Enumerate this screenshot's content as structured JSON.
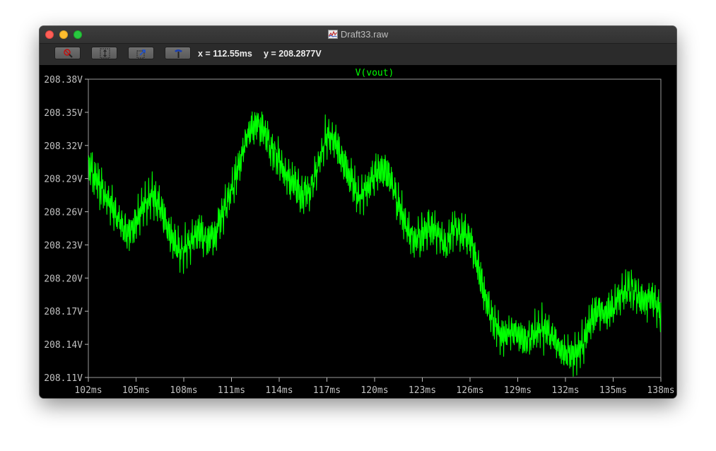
{
  "window": {
    "title": "Draft33.raw"
  },
  "toolbar": {
    "buttons": [
      {
        "name": "zoom-cancel-button",
        "icon": "magnifier-cancel-icon"
      },
      {
        "name": "zoom-extents-button",
        "icon": "zoom-extents-icon"
      },
      {
        "name": "zoom-back-button",
        "icon": "zoom-back-icon"
      },
      {
        "name": "autorange-button",
        "icon": "hammer-icon"
      }
    ],
    "cursor_x": "x = 112.55ms",
    "cursor_y": "y = 208.2877V"
  },
  "colors": {
    "background": "#000000",
    "trace": "#00ff00",
    "axis": "#ffffff",
    "label": "#c0c0c0"
  },
  "chart_data": {
    "type": "line",
    "title": "",
    "series": [
      {
        "name": "V(vout)",
        "color": "#00ff00",
        "x": [
          102.0,
          102.5,
          103.0,
          103.5,
          104.0,
          104.5,
          105.0,
          105.5,
          106.0,
          106.5,
          107.0,
          107.5,
          108.0,
          108.5,
          109.0,
          109.5,
          110.0,
          110.5,
          111.0,
          111.5,
          112.0,
          112.5,
          113.0,
          113.5,
          114.0,
          114.5,
          115.0,
          115.5,
          116.0,
          116.5,
          117.0,
          117.5,
          118.0,
          118.5,
          119.0,
          119.5,
          120.0,
          120.5,
          121.0,
          121.5,
          122.0,
          122.5,
          123.0,
          123.5,
          124.0,
          124.5,
          125.0,
          125.5,
          126.0,
          126.5,
          127.0,
          127.5,
          128.0,
          128.5,
          129.0,
          129.5,
          130.0,
          130.5,
          131.0,
          131.5,
          132.0,
          132.5,
          133.0,
          133.5,
          134.0,
          134.5,
          135.0,
          135.5,
          136.0,
          136.5,
          137.0,
          137.5,
          138.0
        ],
        "y": [
          208.3,
          208.29,
          208.275,
          208.265,
          208.25,
          208.24,
          208.25,
          208.265,
          208.275,
          208.265,
          208.245,
          208.23,
          208.225,
          208.235,
          208.24,
          208.235,
          208.24,
          208.26,
          208.28,
          208.3,
          208.33,
          208.34,
          208.335,
          208.32,
          208.305,
          208.29,
          208.285,
          208.275,
          208.28,
          208.305,
          208.33,
          208.325,
          208.305,
          208.29,
          208.275,
          208.28,
          208.295,
          208.3,
          208.29,
          208.265,
          208.245,
          208.235,
          208.24,
          208.245,
          208.24,
          208.23,
          208.245,
          208.24,
          208.235,
          208.21,
          208.18,
          208.16,
          208.15,
          208.15,
          208.148,
          208.142,
          208.15,
          208.155,
          208.15,
          208.14,
          208.132,
          208.13,
          208.138,
          208.16,
          208.17,
          208.168,
          208.172,
          208.185,
          208.19,
          208.185,
          208.178,
          208.182,
          208.168
        ]
      }
    ],
    "xlabel": "",
    "ylabel": "",
    "xlim": [
      102,
      138
    ],
    "ylim": [
      208.11,
      208.38
    ],
    "x_ticks": [
      "102ms",
      "105ms",
      "108ms",
      "111ms",
      "114ms",
      "117ms",
      "120ms",
      "123ms",
      "126ms",
      "129ms",
      "132ms",
      "135ms",
      "138ms"
    ],
    "y_ticks": [
      "208.38V",
      "208.35V",
      "208.32V",
      "208.29V",
      "208.26V",
      "208.23V",
      "208.20V",
      "208.17V",
      "208.14V",
      "208.11V"
    ],
    "grid": false,
    "legend": "top-center"
  }
}
